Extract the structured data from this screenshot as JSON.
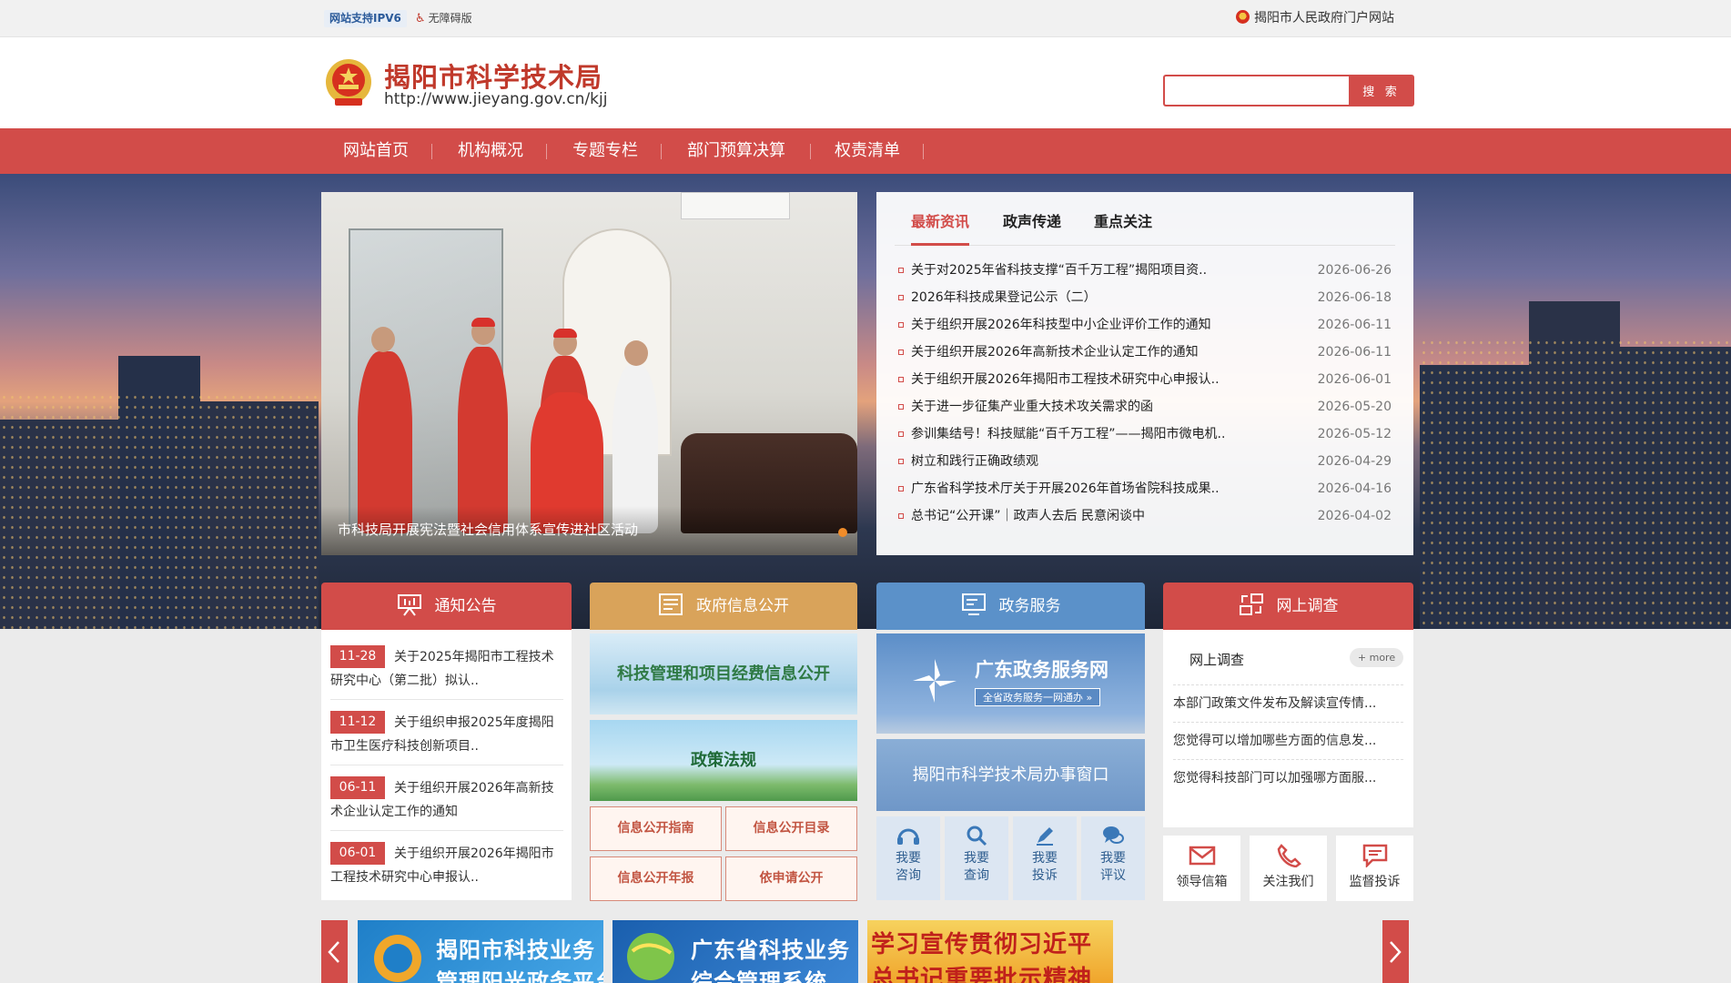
{
  "topbar": {
    "ipv6": "网站支持IPV6",
    "accessibility": "无障碍版",
    "portal_link": "揭阳市人民政府门户网站"
  },
  "header": {
    "title": "揭阳市科学技术局",
    "url": "http://www.jieyang.gov.cn/kjj",
    "search_placeholder": "",
    "search_button": "搜 索"
  },
  "nav": {
    "items": [
      "网站首页",
      "机构概况",
      "专题专栏",
      "部门预算决算",
      "权责清单"
    ]
  },
  "slider": {
    "caption": "市科技局开展宪法暨社会信用体系宣传进社区活动"
  },
  "news": {
    "tabs": [
      "最新资讯",
      "政声传递",
      "重点关注"
    ],
    "items": [
      {
        "title": "关于对2025年省科技支撑“百千万工程”揭阳项目资..",
        "date": "2026-06-26"
      },
      {
        "title": "2026年科技成果登记公示（二）",
        "date": "2026-06-18"
      },
      {
        "title": "关于组织开展2026年科技型中小企业评价工作的通知",
        "date": "2026-06-11"
      },
      {
        "title": "关于组织开展2026年高新技术企业认定工作的通知",
        "date": "2026-06-11"
      },
      {
        "title": "关于组织开展2026年揭阳市工程技术研究中心申报认..",
        "date": "2026-06-01"
      },
      {
        "title": "关于进一步征集产业重大技术攻关需求的函",
        "date": "2026-05-20"
      },
      {
        "title": "参训集结号！科技赋能“百千万工程”——揭阳市微电机..",
        "date": "2026-05-12"
      },
      {
        "title": "树立和践行正确政绩观",
        "date": "2026-04-29"
      },
      {
        "title": "广东省科学技术厅关于开展2026年首场省院科技成果..",
        "date": "2026-04-16"
      },
      {
        "title": "总书记“公开课”｜政声人去后 民意闲谈中",
        "date": "2026-04-02"
      }
    ]
  },
  "sections": {
    "notice": "通知公告",
    "gov_info": "政府信息公开",
    "gov_service": "政务服务",
    "survey": "网上调查"
  },
  "notices": [
    {
      "date": "11-28",
      "text": "关于2025年揭阳市工程技术研究中心（第二批）拟认.."
    },
    {
      "date": "11-12",
      "text": "关于组织申报2025年度揭阳市卫生医疗科技创新项目.."
    },
    {
      "date": "06-11",
      "text": "关于组织开展2026年高新技术企业认定工作的通知"
    },
    {
      "date": "06-01",
      "text": "关于组织开展2026年揭阳市工程技术研究中心申报认.."
    }
  ],
  "gov_info": {
    "banner1": "科技管理和项目经费信息公开",
    "banner2": "政策法规",
    "buttons": [
      "信息公开指南",
      "信息公开目录",
      "信息公开年报",
      "依申请公开"
    ]
  },
  "gov_service": {
    "gd_title": "广东政务服务网",
    "gd_sub": "全省政务服务一网通办 »",
    "window": "揭阳市科学技术局办事窗口",
    "services": [
      {
        "l1": "我要",
        "l2": "咨询",
        "icon": "consult-icon"
      },
      {
        "l1": "我要",
        "l2": "查询",
        "icon": "query-icon"
      },
      {
        "l1": "我要",
        "l2": "投诉",
        "icon": "complaint-icon"
      },
      {
        "l1": "我要",
        "l2": "评议",
        "icon": "review-icon"
      }
    ]
  },
  "survey": {
    "heading": "网上调查",
    "more": "+ more",
    "questions": [
      "本部门政策文件发布及解读宣传情...",
      "您觉得可以增加哪些方面的信息发...",
      "您觉得科技部门可以加强哪方面服..."
    ],
    "contacts": [
      "领导信箱",
      "关注我们",
      "监督投诉"
    ]
  },
  "carousel": {
    "items": [
      {
        "line1": "揭阳市科技业务",
        "line2": "管理阳光政务平台"
      },
      {
        "line1": "广东省科技业务",
        "line2": "综合管理系统"
      },
      {
        "line1": "学习宣传贯彻习近平",
        "line2": "总书记重要批示精神"
      }
    ]
  },
  "colors": {
    "brand_red": "#d24c49",
    "gov_orange": "#d9a35a",
    "service_blue": "#5b91c9"
  }
}
